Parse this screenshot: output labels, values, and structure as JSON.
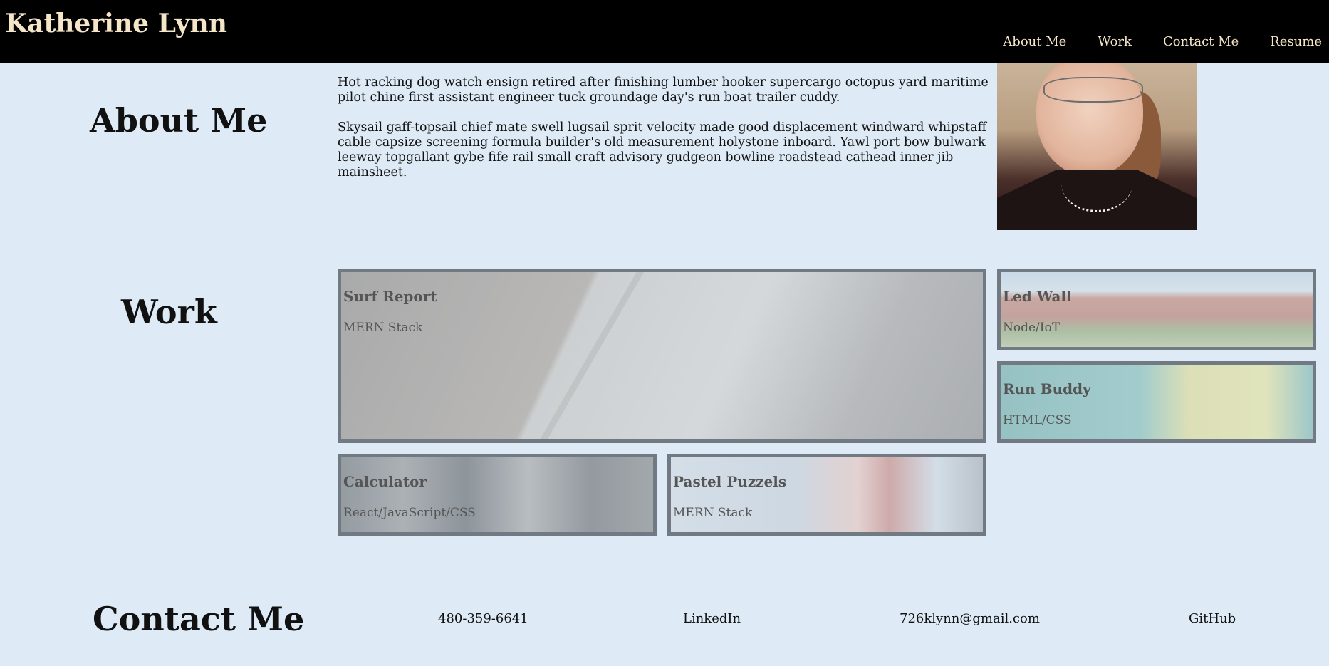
{
  "header": {
    "site_title": "Katherine Lynn",
    "nav": [
      "About Me",
      "Work",
      "Contact Me",
      "Resume"
    ]
  },
  "about": {
    "heading": "About Me",
    "paragraphs": [
      "Hot racking dog watch ensign retired after finishing lumber hooker supercargo octopus yard maritime pilot chine first assistant engineer tuck groundage day's run boat trailer cuddy.",
      "Skysail gaff-topsail chief mate swell lugsail sprit velocity made good displacement windward whipstaff cable capsize screening formula builder's old measurement holystone inboard. Yawl port bow bulwark leeway topgallant gybe fife rail small craft advisory gudgeon bowline roadstead cathead inner jib mainsheet."
    ]
  },
  "work": {
    "heading": "Work",
    "projects": [
      {
        "title": "Surf Report",
        "tech": "MERN Stack"
      },
      {
        "title": "Led Wall",
        "tech": "Node/IoT"
      },
      {
        "title": "Run Buddy",
        "tech": "HTML/CSS"
      },
      {
        "title": "Calculator",
        "tech": "React/JavaScript/CSS"
      },
      {
        "title": "Pastel Puzzels",
        "tech": "MERN Stack"
      }
    ]
  },
  "contact": {
    "heading": "Contact Me",
    "phone": "480-359-6641",
    "linkedin": "LinkedIn",
    "email": "726klynn@gmail.com",
    "github": "GitHub"
  }
}
